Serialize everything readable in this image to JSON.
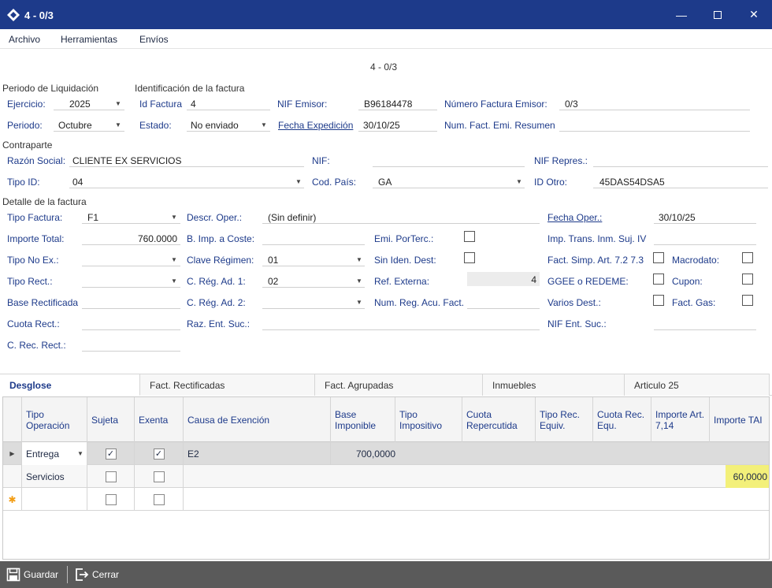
{
  "window": {
    "title": "4 - 0/3",
    "header_caption": "4 - 0/3"
  },
  "menu": [
    "Archivo",
    "Herramientas",
    "Envíos"
  ],
  "sections": {
    "periodo": "Periodo de Liquidación",
    "identificacion": "Identificación de la factura",
    "contraparte": "Contraparte",
    "detalle": "Detalle de la factura"
  },
  "fields": {
    "ejercicio": {
      "label": "Ejercicio:",
      "value": "2025"
    },
    "periodo": {
      "label": "Periodo:",
      "value": "Octubre"
    },
    "id_factura": {
      "label": "Id Factura",
      "value": "4"
    },
    "estado": {
      "label": "Estado:",
      "value": "No enviado"
    },
    "nif_emisor": {
      "label": "NIF Emisor:",
      "value": "B96184478"
    },
    "fecha_expedicion": {
      "label": "Fecha Expedición",
      "value": "30/10/25"
    },
    "num_factura_emisor": {
      "label": "Número Factura Emisor:",
      "value": "0/3"
    },
    "num_fact_emi_resumen": {
      "label": "Num. Fact. Emi. Resumen",
      "value": ""
    },
    "razon_social": {
      "label": "Razón Social:",
      "value": "CLIENTE EX SERVICIOS"
    },
    "nif": {
      "label": "NIF:",
      "value": ""
    },
    "nif_repres": {
      "label": "NIF Repres.:",
      "value": ""
    },
    "tipo_id": {
      "label": "Tipo ID:",
      "value": "04"
    },
    "cod_pais": {
      "label": "Cod. País:",
      "value": "GA"
    },
    "id_otro": {
      "label": "ID Otro:",
      "value": "45DAS54DSA5"
    },
    "tipo_factura": {
      "label": "Tipo Factura:",
      "value": "F1"
    },
    "descr_oper": {
      "label": "Descr. Oper.:",
      "value": "(Sin definir)"
    },
    "fecha_oper": {
      "label": "Fecha Oper.:",
      "value": "30/10/25"
    },
    "importe_total": {
      "label": "Importe Total:",
      "value": "760.0000"
    },
    "b_imp_coste": {
      "label": "B. Imp. a Coste:",
      "value": ""
    },
    "emi_porterc": {
      "label": "Emi. PorTerc.:"
    },
    "imp_trans": {
      "label": "Imp. Trans. Inm. Suj. IV",
      "value": ""
    },
    "tipo_no_ex": {
      "label": "Tipo No Ex.:",
      "value": ""
    },
    "clave_regimen": {
      "label": "Clave Régimen:",
      "value": "01"
    },
    "sin_iden_dest": {
      "label": "Sin Iden. Dest:"
    },
    "fact_simp": {
      "label": "Fact. Simp. Art. 7.2 7.3"
    },
    "macrodato": {
      "label": "Macrodato:"
    },
    "tipo_rect": {
      "label": "Tipo Rect.:",
      "value": ""
    },
    "c_reg_ad1": {
      "label": "C. Rég. Ad. 1:",
      "value": "02"
    },
    "ref_externa": {
      "label": "Ref. Externa:",
      "value": "4"
    },
    "ggee": {
      "label": "GGEE o REDEME:"
    },
    "cupon": {
      "label": "Cupon:"
    },
    "base_rectificada": {
      "label": "Base Rectificada",
      "value": ""
    },
    "c_reg_ad2": {
      "label": "C. Rég. Ad. 2:",
      "value": ""
    },
    "num_reg_acu": {
      "label": "Num. Reg. Acu. Fact.",
      "value": ""
    },
    "varios_dest": {
      "label": "Varios Dest.:"
    },
    "fact_gas": {
      "label": "Fact. Gas:"
    },
    "cuota_rect": {
      "label": "Cuota Rect.:",
      "value": ""
    },
    "raz_ent_suc": {
      "label": "Raz. Ent. Suc.:",
      "value": ""
    },
    "nif_ent_suc": {
      "label": "NIF Ent. Suc.:",
      "value": ""
    },
    "c_rec_rect": {
      "label": "C. Rec. Rect.:",
      "value": ""
    }
  },
  "tabs": [
    "Desglose",
    "Fact. Rectificadas",
    "Fact. Agrupadas",
    "Inmuebles",
    "Articulo 25"
  ],
  "grid": {
    "headers": [
      "Tipo Operación",
      "Sujeta",
      "Exenta",
      "Causa de Exención",
      "Base Imponible",
      "Tipo Impositivo",
      "Cuota Repercutida",
      "Tipo Rec. Equiv.",
      "Cuota Rec. Equ.",
      "Importe Art. 7,14",
      "Importe TAI"
    ],
    "rows": [
      {
        "tipo": "Entrega",
        "sujeta": true,
        "exenta": true,
        "causa": "E2",
        "base": "700,0000",
        "tai": ""
      },
      {
        "tipo": "Servicios",
        "sujeta": false,
        "exenta": false,
        "causa": "",
        "base": "",
        "tai": "60,0000"
      },
      {
        "tipo": "",
        "sujeta": false,
        "exenta": false,
        "causa": "",
        "base": "",
        "tai": ""
      }
    ]
  },
  "footer": {
    "save": "Guardar",
    "close": "Cerrar"
  },
  "colors": {
    "titlebar": "#1d3a8a",
    "highlight": "#f3f07a",
    "footer": "#5a5a5a"
  }
}
